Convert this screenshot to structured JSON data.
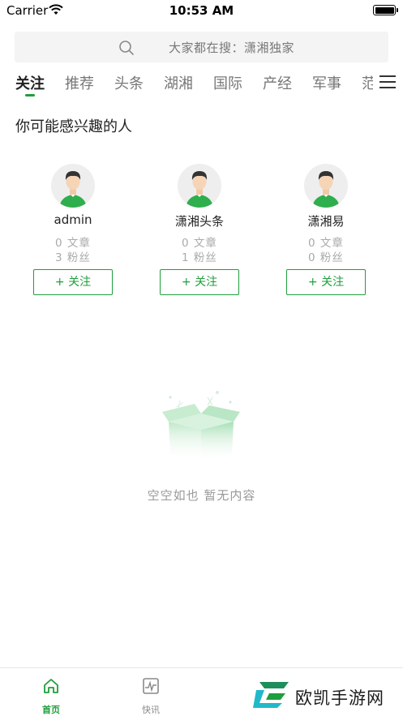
{
  "status_bar": {
    "carrier": "Carrier",
    "time": "10:53 AM"
  },
  "search": {
    "placeholder": "大家都在搜：潇湘独家"
  },
  "tabs": [
    {
      "label": "关注",
      "active": true
    },
    {
      "label": "推荐",
      "active": false
    },
    {
      "label": "头条",
      "active": false
    },
    {
      "label": "湖湘",
      "active": false
    },
    {
      "label": "国际",
      "active": false
    },
    {
      "label": "产经",
      "active": false
    },
    {
      "label": "军事",
      "active": false
    },
    {
      "label": "范",
      "active": false
    }
  ],
  "section_title": "你可能感兴趣的人",
  "people": [
    {
      "name": "admin",
      "articles": "0 文章",
      "fans": "3 粉丝",
      "follow_label": "+ 关注"
    },
    {
      "name": "潇湘头条",
      "articles": "0 文章",
      "fans": "1 粉丝",
      "follow_label": "+ 关注"
    },
    {
      "name": "潇湘易",
      "articles": "0 文章",
      "fans": "0 粉丝",
      "follow_label": "+ 关注"
    }
  ],
  "empty_state": {
    "text": "空空如也 暂无内容"
  },
  "bottom_nav": [
    {
      "label": "首页",
      "icon": "home-icon",
      "active": true
    },
    {
      "label": "快讯",
      "icon": "pulse-icon",
      "active": false
    }
  ],
  "watermark": {
    "text": "欧凯手游网"
  },
  "colors": {
    "accent": "#1f9e3c",
    "muted": "#999999",
    "search_bg": "#f4f4f4"
  }
}
